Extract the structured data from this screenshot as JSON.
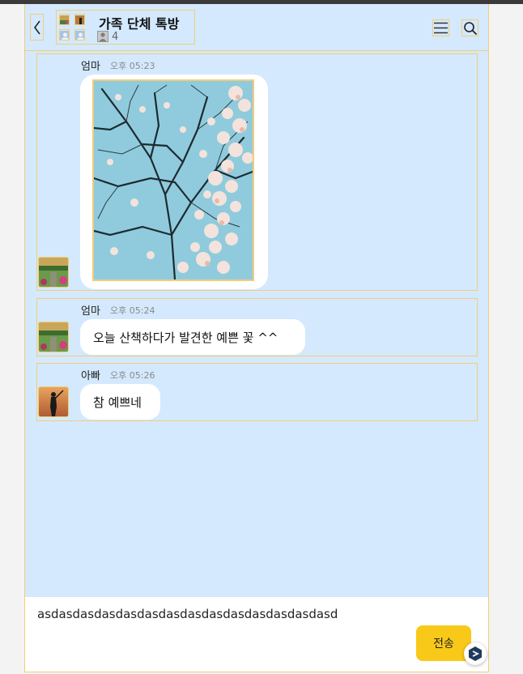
{
  "header": {
    "title": "가족 단체 톡방",
    "member_count": "4"
  },
  "messages": [
    {
      "sender": "엄마",
      "time": "오후 05:23",
      "type": "image"
    },
    {
      "sender": "엄마",
      "time": "오후 05:24",
      "type": "text",
      "text": "오늘 산책하다가 발견한 예쁜 꽃 ^^"
    },
    {
      "sender": "아빠",
      "time": "오후 05:26",
      "type": "text",
      "text": "참 예쁘네"
    }
  ],
  "composer": {
    "value": "asdasdasdasdasdasdasdasdasdasdasdasdasdasd",
    "send_label": "전송"
  },
  "colors": {
    "background": "#d4e9fd",
    "accent": "#f8c918",
    "outline": "#f2cd7a"
  }
}
